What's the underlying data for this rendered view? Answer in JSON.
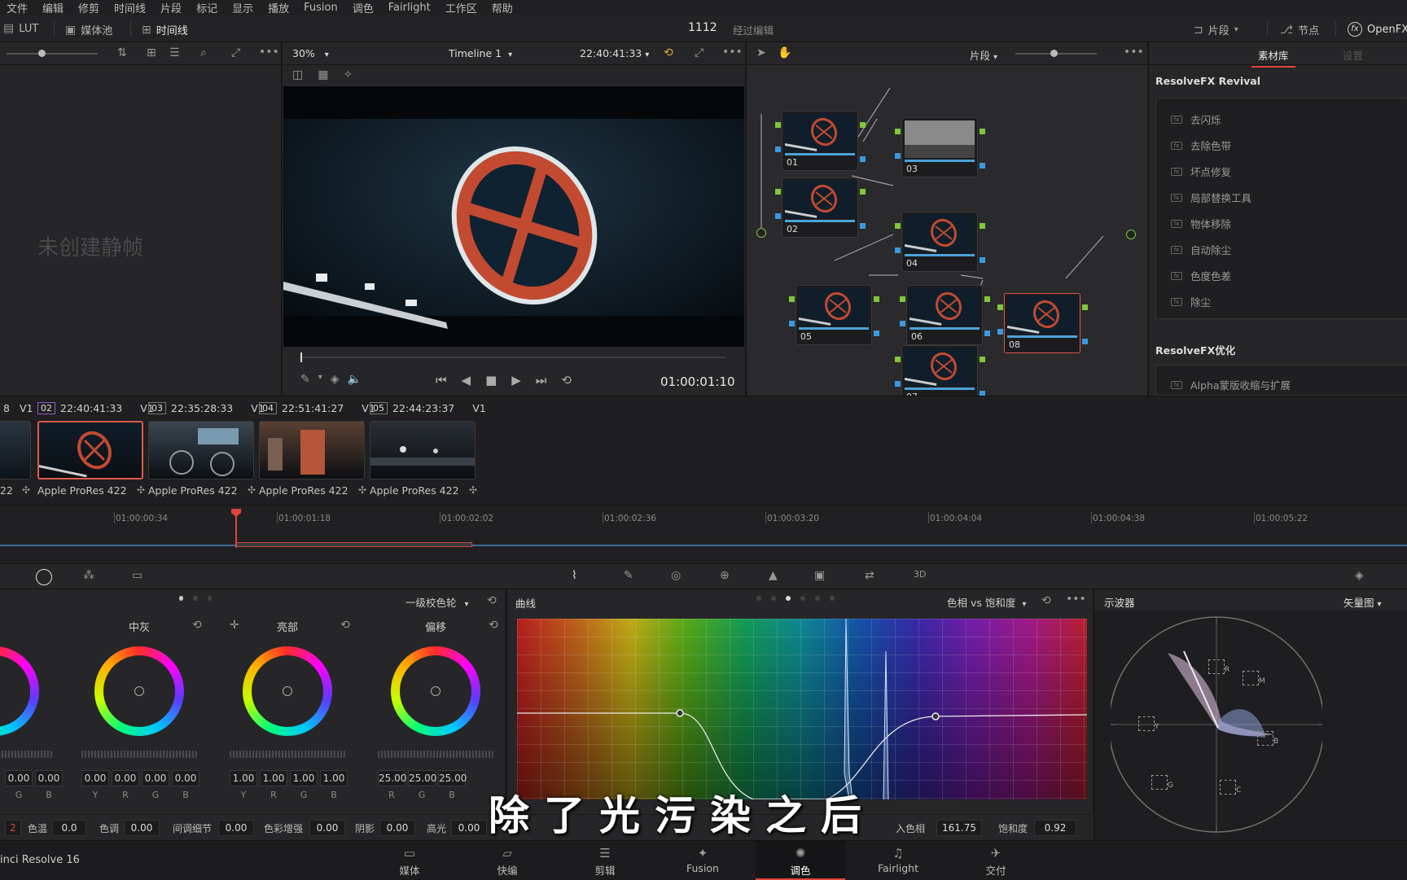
{
  "menu": [
    "文件",
    "编辑",
    "修剪",
    "时间线",
    "片段",
    "标记",
    "显示",
    "播放",
    "Fusion",
    "调色",
    "Fairlight",
    "工作区",
    "帮助"
  ],
  "topbar": {
    "lut": "LUT",
    "media_pool": "媒体池",
    "timeline": "时间线",
    "project_name": "1112",
    "project_status": "经过编辑",
    "clip_mode": "片段",
    "nodes": "节点",
    "openfx": "OpenFX"
  },
  "gallery": {
    "empty_text": "未创建静帧"
  },
  "viewer": {
    "zoom": "30%",
    "timeline_name": "Timeline 1",
    "source_tc": "22:40:41:33",
    "playhead_tc": "01:00:01:10"
  },
  "nodes_panel": {
    "mode": "片段",
    "nodes": [
      {
        "id": "01",
        "label": "01"
      },
      {
        "id": "02",
        "label": "02"
      },
      {
        "id": "03",
        "label": "03"
      },
      {
        "id": "04",
        "label": "04"
      },
      {
        "id": "05",
        "label": "05"
      },
      {
        "id": "06",
        "label": "06"
      },
      {
        "id": "07",
        "label": "07"
      },
      {
        "id": "08",
        "label": "08"
      }
    ]
  },
  "library": {
    "tab_library": "素材库",
    "tab_settings": "设置",
    "section1": "ResolveFX Revival",
    "section1_items": [
      "去闪烁",
      "去除色带",
      "坏点修复",
      "局部替换工具",
      "物体移除",
      "自动除尘",
      "色度色差",
      "除尘"
    ],
    "section2": "ResolveFX优化",
    "section2_items": [
      "Alpha蒙版收缩与扩展"
    ]
  },
  "clips": {
    "partial_left": {
      "num": "8",
      "track": "V1",
      "codec": "22"
    },
    "items": [
      {
        "num": "02",
        "tc": "22:40:41:33",
        "track": "V1",
        "codec": "Apple ProRes 422",
        "selected": true
      },
      {
        "num": "03",
        "tc": "22:35:28:33",
        "track": "V1",
        "codec": "Apple ProRes 422",
        "selected": false
      },
      {
        "num": "04",
        "tc": "22:51:41:27",
        "track": "V1",
        "codec": "Apple ProRes 422",
        "selected": false
      },
      {
        "num": "05",
        "tc": "22:44:23:37",
        "track": "V1",
        "codec": "Apple ProRes 422",
        "selected": false
      }
    ]
  },
  "ruler": {
    "ticks": [
      "01:00:00:34",
      "01:00:01:18",
      "01:00:02:02",
      "01:00:02:36",
      "01:00:03:20",
      "01:00:04:04",
      "01:00:04:38",
      "01:00:05:22"
    ]
  },
  "wheels": {
    "mode": "一级校色轮",
    "items": [
      {
        "title": "",
        "values": [
          "0.00",
          "0.00"
        ],
        "chans": [
          "G",
          "B"
        ]
      },
      {
        "title": "中灰",
        "values": [
          "0.00",
          "0.00",
          "0.00",
          "0.00"
        ],
        "chans": [
          "Y",
          "R",
          "G",
          "B"
        ]
      },
      {
        "title": "亮部",
        "values": [
          "1.00",
          "1.00",
          "1.00",
          "1.00"
        ],
        "chans": [
          "Y",
          "R",
          "G",
          "B"
        ]
      },
      {
        "title": "偏移",
        "values": [
          "25.00",
          "25.00",
          "25.00"
        ],
        "chans": [
          "R",
          "G",
          "B"
        ]
      }
    ]
  },
  "params": {
    "page_num": "2",
    "temp_label": "色温",
    "temp": "0.0",
    "tint_label": "色调",
    "tint": "0.00",
    "detail_label": "间调细节",
    "detail": "0.00",
    "boost_label": "色彩增强",
    "boost": "0.00",
    "shadow_label": "阴影",
    "shadow": "0.00",
    "hl_label": "高光",
    "hl": "0.00",
    "hue_in_label": "入色相",
    "hue_in": "161.75",
    "sat_label": "饱和度",
    "sat": "0.92"
  },
  "curves": {
    "title": "曲线",
    "mode": "色相 vs 饱和度"
  },
  "scopes": {
    "title": "示波器",
    "mode": "矢量图",
    "targets": [
      "R",
      "M",
      "B",
      "C",
      "G",
      "Y"
    ]
  },
  "subtitle": "除了光污染之后",
  "app_name": "inci Resolve 16",
  "pages": [
    {
      "label": "媒体",
      "icon": "▭",
      "active": false
    },
    {
      "label": "快编",
      "icon": "▱",
      "active": false
    },
    {
      "label": "剪辑",
      "icon": "☰",
      "active": false
    },
    {
      "label": "Fusion",
      "icon": "✦",
      "active": false
    },
    {
      "label": "调色",
      "icon": "✺",
      "active": true
    },
    {
      "label": "Fairlight",
      "icon": "♫",
      "active": false
    },
    {
      "label": "交付",
      "icon": "✈",
      "active": false
    }
  ]
}
